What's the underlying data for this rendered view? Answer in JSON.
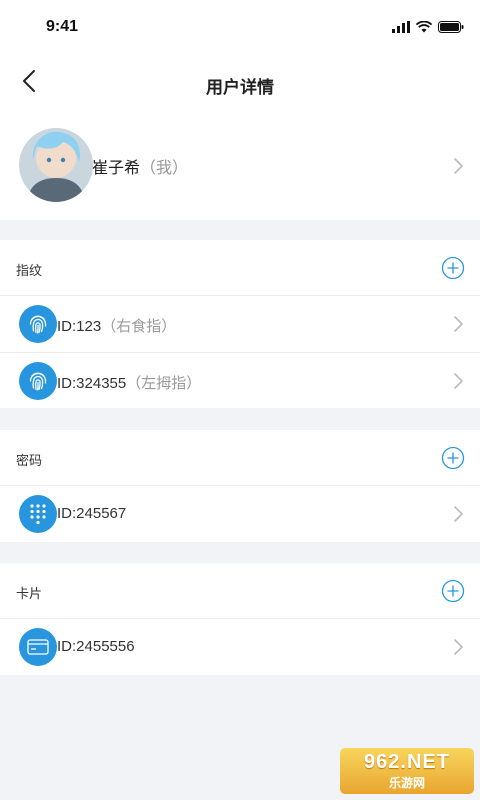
{
  "status_bar": {
    "time": "9:41"
  },
  "nav": {
    "title": "用户详情"
  },
  "profile": {
    "name": "崔子希",
    "suffix": "（我）"
  },
  "sections": {
    "fingerprint": {
      "title": "指纹",
      "items": [
        {
          "id": "ID:123",
          "note": "（右食指）"
        },
        {
          "id": "ID:324355",
          "note": "（左拇指）"
        }
      ]
    },
    "password": {
      "title": "密码",
      "items": [
        {
          "id": "ID:245567"
        }
      ]
    },
    "card": {
      "title": "卡片",
      "items": [
        {
          "id": "ID:2455556"
        }
      ]
    }
  },
  "watermark": {
    "top": "962.NET",
    "bottom": "乐游网"
  },
  "colors": {
    "accent": "#2796de",
    "background": "#f2f3f6"
  },
  "icons": [
    "signal-icon",
    "wifi-icon",
    "battery-icon",
    "back-arrow-icon",
    "chevron-right-icon",
    "add-circle-icon",
    "fingerprint-icon",
    "keypad-icon",
    "card-icon"
  ]
}
